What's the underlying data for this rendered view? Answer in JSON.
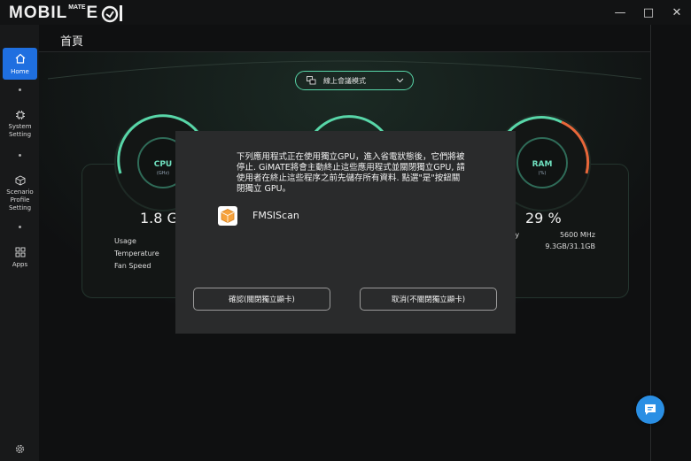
{
  "app": {
    "logo_text_left": "MOBIL",
    "logo_text_sup": "MATE",
    "logo_text_right": "E"
  },
  "window_controls": {
    "minimize": "—",
    "maximize": "□",
    "close": "✕"
  },
  "sidebar": {
    "items": [
      {
        "label": "Home",
        "icon": "home-icon",
        "active": true
      },
      {
        "label": "System Setting",
        "icon": "chip-icon",
        "active": false
      },
      {
        "label": "Scenario Profile Setting",
        "icon": "cube-icon",
        "active": false
      },
      {
        "label": "Apps",
        "icon": "grid-icon",
        "active": false
      }
    ],
    "bottom_icon": "gear-icon"
  },
  "header": {
    "title": "首頁"
  },
  "mode_select": {
    "value": "線上會議模式",
    "icon": "meeting-icon"
  },
  "cpu_card": {
    "gauge_label": "CPU",
    "gauge_sub": "(GHz)",
    "value": "1.8 GH",
    "stats": [
      "Usage",
      "Temperature",
      "Fan Speed"
    ]
  },
  "ram_card": {
    "gauge_label": "RAM",
    "gauge_sub": "(%)",
    "value": "29 %",
    "stats": [
      {
        "label": "ency",
        "value": "5600 MHz"
      },
      {
        "label": "",
        "value": "9.3GB/31.1GB"
      }
    ]
  },
  "dialog": {
    "message": "下列應用程式正在使用獨立GPU，進入省電狀態後，它們將被停止. GiMATE將會主動終止這些應用程式並關閉獨立GPU, 請使用者在終止這些程序之前先儲存所有資料. 點選\"是\"按鈕關閉獨立 GPU。",
    "app_name": "FMSIScan",
    "app_icon": "package-icon",
    "confirm_label": "確認(關閉獨立顯卡)",
    "cancel_label": "取消(不關閉獨立顯卡)"
  },
  "chat_button": {
    "icon": "chat-icon"
  },
  "colors": {
    "accent": "#58d6a8",
    "active_nav": "#1f6fe0",
    "warning_arc": "#e8673a",
    "fab": "#2a8fe4"
  }
}
